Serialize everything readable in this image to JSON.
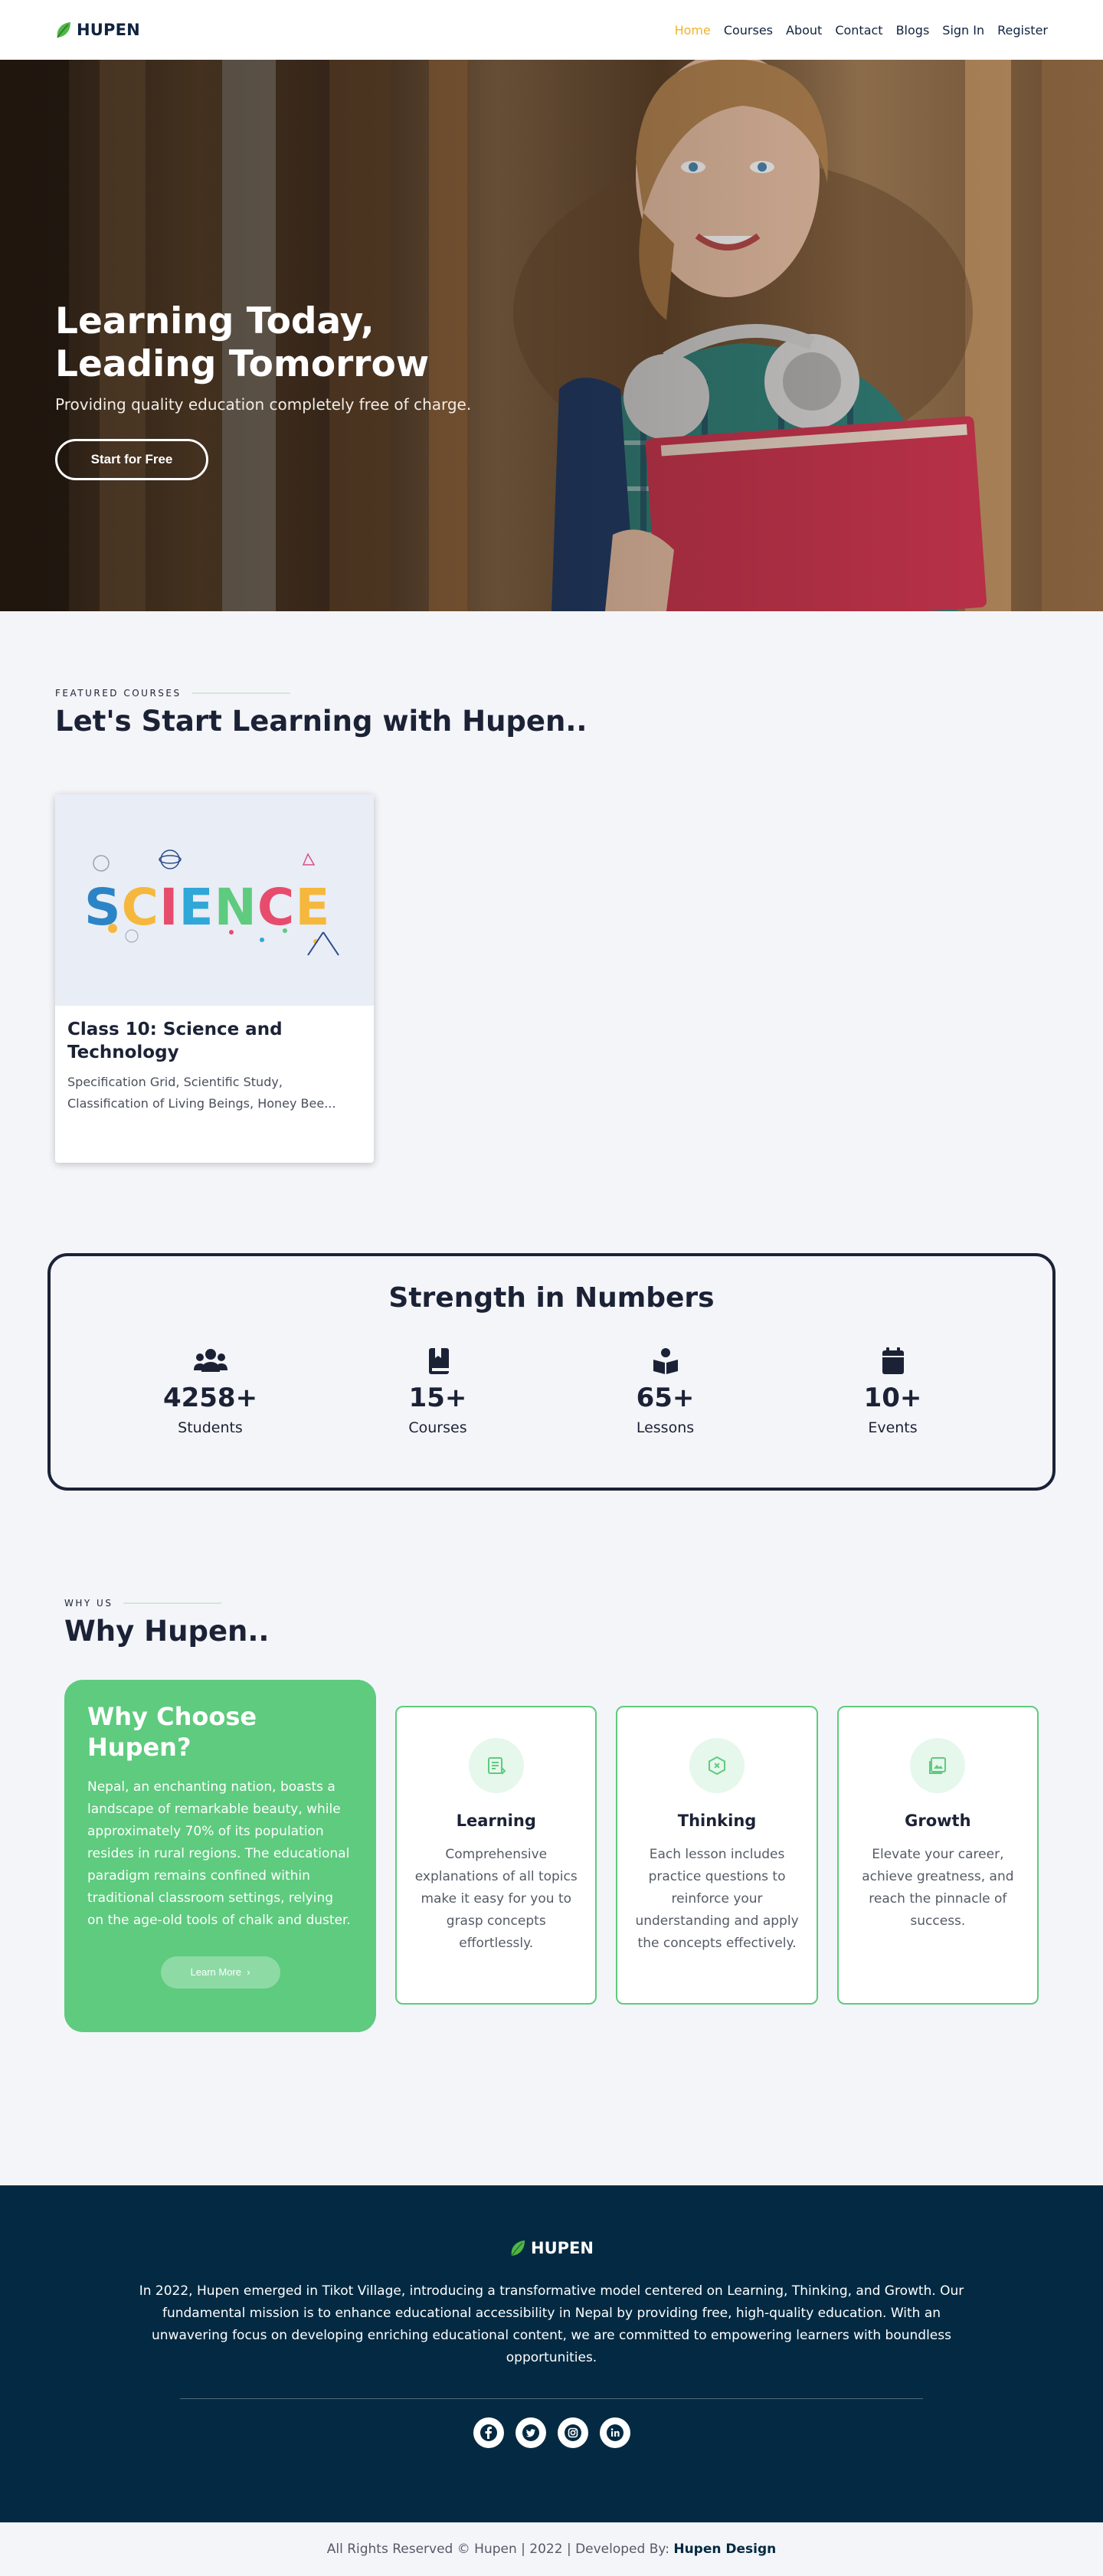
{
  "brand": {
    "name": "HUPEN"
  },
  "nav": [
    {
      "label": "Home",
      "active": true
    },
    {
      "label": "Courses"
    },
    {
      "label": "About"
    },
    {
      "label": "Contact"
    },
    {
      "label": "Blogs"
    },
    {
      "label": "Sign In"
    },
    {
      "label": "Register"
    }
  ],
  "hero": {
    "title_line1": "Learning Today,",
    "title_line2": "Leading Tomorrow",
    "subtitle": "Providing quality education completely free of charge.",
    "cta": "Start for Free"
  },
  "featured": {
    "eyebrow": "FEATURED COURSES",
    "title": "Let's Start Learning with Hupen..",
    "course": {
      "image_word": "SCIENCE",
      "title": "Class 10: Science and Technology",
      "description": "Specification Grid, Scientific Study, Classification of Living Beings, Honey Bee..."
    }
  },
  "stats": {
    "title": "Strength in Numbers",
    "items": [
      {
        "icon": "users-icon",
        "value": "4258+",
        "label": "Students"
      },
      {
        "icon": "book-icon",
        "value": "15+",
        "label": "Courses"
      },
      {
        "icon": "open-book-reader-icon",
        "value": "65+",
        "label": "Lessons"
      },
      {
        "icon": "calendar-icon",
        "value": "10+",
        "label": "Events"
      }
    ]
  },
  "why": {
    "eyebrow": "WHY US",
    "title": "Why Hupen..",
    "choose_title": "Why Choose Hupen?",
    "choose_text": "Nepal, an enchanting nation, boasts a landscape of remarkable beauty, while approximately 70% of its population resides in rural regions. The educational paradigm remains confined within traditional classroom settings, relying on the age-old tools of chalk and duster.",
    "learn_more": "Learn More",
    "cards": [
      {
        "icon": "notes-icon",
        "title": "Learning",
        "text": "Comprehensive explanations of all topics make it easy for you to grasp concepts effortlessly."
      },
      {
        "icon": "hexagon-icon",
        "title": "Thinking",
        "text": "Each lesson includes practice questions to reinforce your understanding and apply the concepts effectively."
      },
      {
        "icon": "image-icon",
        "title": "Growth",
        "text": "Elevate your career, achieve greatness, and reach the pinnacle of success."
      }
    ]
  },
  "footer": {
    "brand": "HUPEN",
    "text": "In 2022, Hupen emerged in Tikot Village, introducing a transformative model centered on Learning, Thinking, and Growth. Our fundamental mission is to enhance educational accessibility in Nepal by providing free, high-quality education. With an unwavering focus on developing enriching educational content, we are committed to empowering learners with boundless opportunities.",
    "socials": [
      "facebook-icon",
      "twitter-icon",
      "instagram-icon",
      "linkedin-icon"
    ],
    "copyright": "All Rights Reserved © Hupen | 2022 | Developed By:",
    "developer": "Hupen Design"
  },
  "colors": {
    "accent": "#f0b429",
    "green": "#5ecb7e",
    "navy": "#032a42",
    "ink": "#1c2236"
  }
}
